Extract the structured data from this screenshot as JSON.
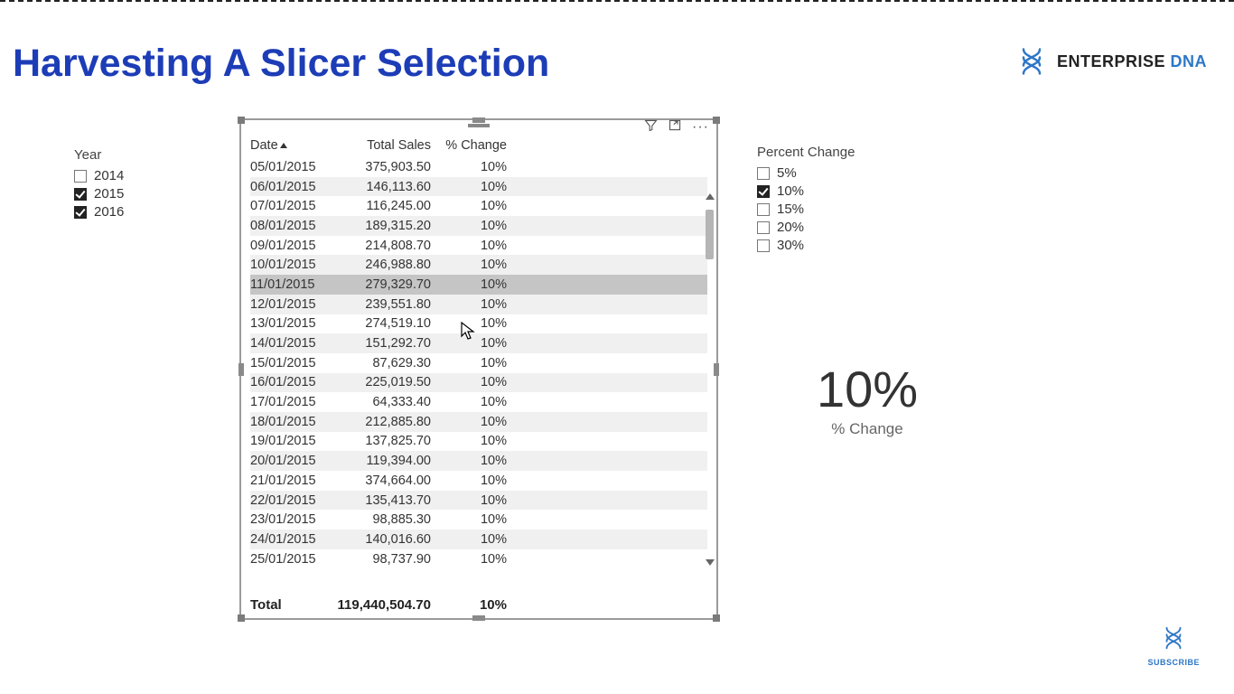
{
  "title": "Harvesting A Slicer Selection",
  "logo": {
    "text1": "ENTERPRISE ",
    "text2": "DNA"
  },
  "year_slicer": {
    "label": "Year",
    "items": [
      {
        "label": "2014",
        "checked": false
      },
      {
        "label": "2015",
        "checked": true
      },
      {
        "label": "2016",
        "checked": true
      }
    ]
  },
  "pct_slicer": {
    "label": "Percent Change",
    "items": [
      {
        "label": "5%",
        "checked": false
      },
      {
        "label": "10%",
        "checked": true
      },
      {
        "label": "15%",
        "checked": false
      },
      {
        "label": "20%",
        "checked": false
      },
      {
        "label": "30%",
        "checked": false
      }
    ]
  },
  "table": {
    "headers": {
      "date": "Date",
      "sales": "Total Sales",
      "chg": "% Change"
    },
    "rows": [
      {
        "date": "05/01/2015",
        "sales": "375,903.50",
        "chg": "10%"
      },
      {
        "date": "06/01/2015",
        "sales": "146,113.60",
        "chg": "10%"
      },
      {
        "date": "07/01/2015",
        "sales": "116,245.00",
        "chg": "10%"
      },
      {
        "date": "08/01/2015",
        "sales": "189,315.20",
        "chg": "10%"
      },
      {
        "date": "09/01/2015",
        "sales": "214,808.70",
        "chg": "10%"
      },
      {
        "date": "10/01/2015",
        "sales": "246,988.80",
        "chg": "10%"
      },
      {
        "date": "11/01/2015",
        "sales": "279,329.70",
        "chg": "10%"
      },
      {
        "date": "12/01/2015",
        "sales": "239,551.80",
        "chg": "10%"
      },
      {
        "date": "13/01/2015",
        "sales": "274,519.10",
        "chg": "10%"
      },
      {
        "date": "14/01/2015",
        "sales": "151,292.70",
        "chg": "10%"
      },
      {
        "date": "15/01/2015",
        "sales": "87,629.30",
        "chg": "10%"
      },
      {
        "date": "16/01/2015",
        "sales": "225,019.50",
        "chg": "10%"
      },
      {
        "date": "17/01/2015",
        "sales": "64,333.40",
        "chg": "10%"
      },
      {
        "date": "18/01/2015",
        "sales": "212,885.80",
        "chg": "10%"
      },
      {
        "date": "19/01/2015",
        "sales": "137,825.70",
        "chg": "10%"
      },
      {
        "date": "20/01/2015",
        "sales": "119,394.00",
        "chg": "10%"
      },
      {
        "date": "21/01/2015",
        "sales": "374,664.00",
        "chg": "10%"
      },
      {
        "date": "22/01/2015",
        "sales": "135,413.70",
        "chg": "10%"
      },
      {
        "date": "23/01/2015",
        "sales": "98,885.30",
        "chg": "10%"
      },
      {
        "date": "24/01/2015",
        "sales": "140,016.60",
        "chg": "10%"
      },
      {
        "date": "25/01/2015",
        "sales": "98,737.90",
        "chg": "10%"
      }
    ],
    "highlight_index": 6,
    "total": {
      "label": "Total",
      "sales": "119,440,504.70",
      "chg": "10%"
    }
  },
  "card": {
    "value": "10%",
    "label": "% Change"
  },
  "subscribe": "SUBSCRIBE"
}
